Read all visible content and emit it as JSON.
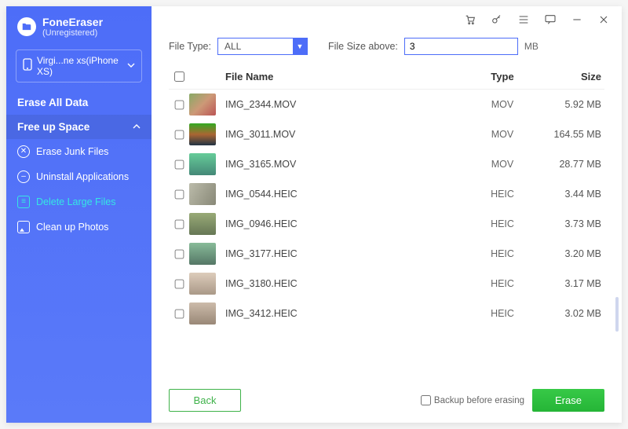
{
  "brand": {
    "title": "FoneEraser",
    "subtitle": "(Unregistered)"
  },
  "device": {
    "label": "Virgi...ne xs(iPhone XS)"
  },
  "sidebar": {
    "erase_all": "Erase All Data",
    "free_up": "Free up Space",
    "items": [
      {
        "label": "Erase Junk Files"
      },
      {
        "label": "Uninstall Applications"
      },
      {
        "label": "Delete Large Files"
      },
      {
        "label": "Clean up Photos"
      }
    ]
  },
  "filters": {
    "file_type_label": "File Type:",
    "file_type_value": "ALL",
    "file_size_label": "File Size above:",
    "file_size_value": "3",
    "file_size_unit": "MB"
  },
  "columns": {
    "name": "File Name",
    "type": "Type",
    "size": "Size"
  },
  "files": [
    {
      "name": "IMG_2344.MOV",
      "type": "MOV",
      "size": "5.92 MB"
    },
    {
      "name": "IMG_3011.MOV",
      "type": "MOV",
      "size": "164.55 MB"
    },
    {
      "name": "IMG_3165.MOV",
      "type": "MOV",
      "size": "28.77 MB"
    },
    {
      "name": "IMG_0544.HEIC",
      "type": "HEIC",
      "size": "3.44 MB"
    },
    {
      "name": "IMG_0946.HEIC",
      "type": "HEIC",
      "size": "3.73 MB"
    },
    {
      "name": "IMG_3177.HEIC",
      "type": "HEIC",
      "size": "3.20 MB"
    },
    {
      "name": "IMG_3180.HEIC",
      "type": "HEIC",
      "size": "3.17 MB"
    },
    {
      "name": "IMG_3412.HEIC",
      "type": "HEIC",
      "size": "3.02 MB"
    }
  ],
  "footer": {
    "back": "Back",
    "backup_label": "Backup before erasing",
    "erase": "Erase"
  }
}
